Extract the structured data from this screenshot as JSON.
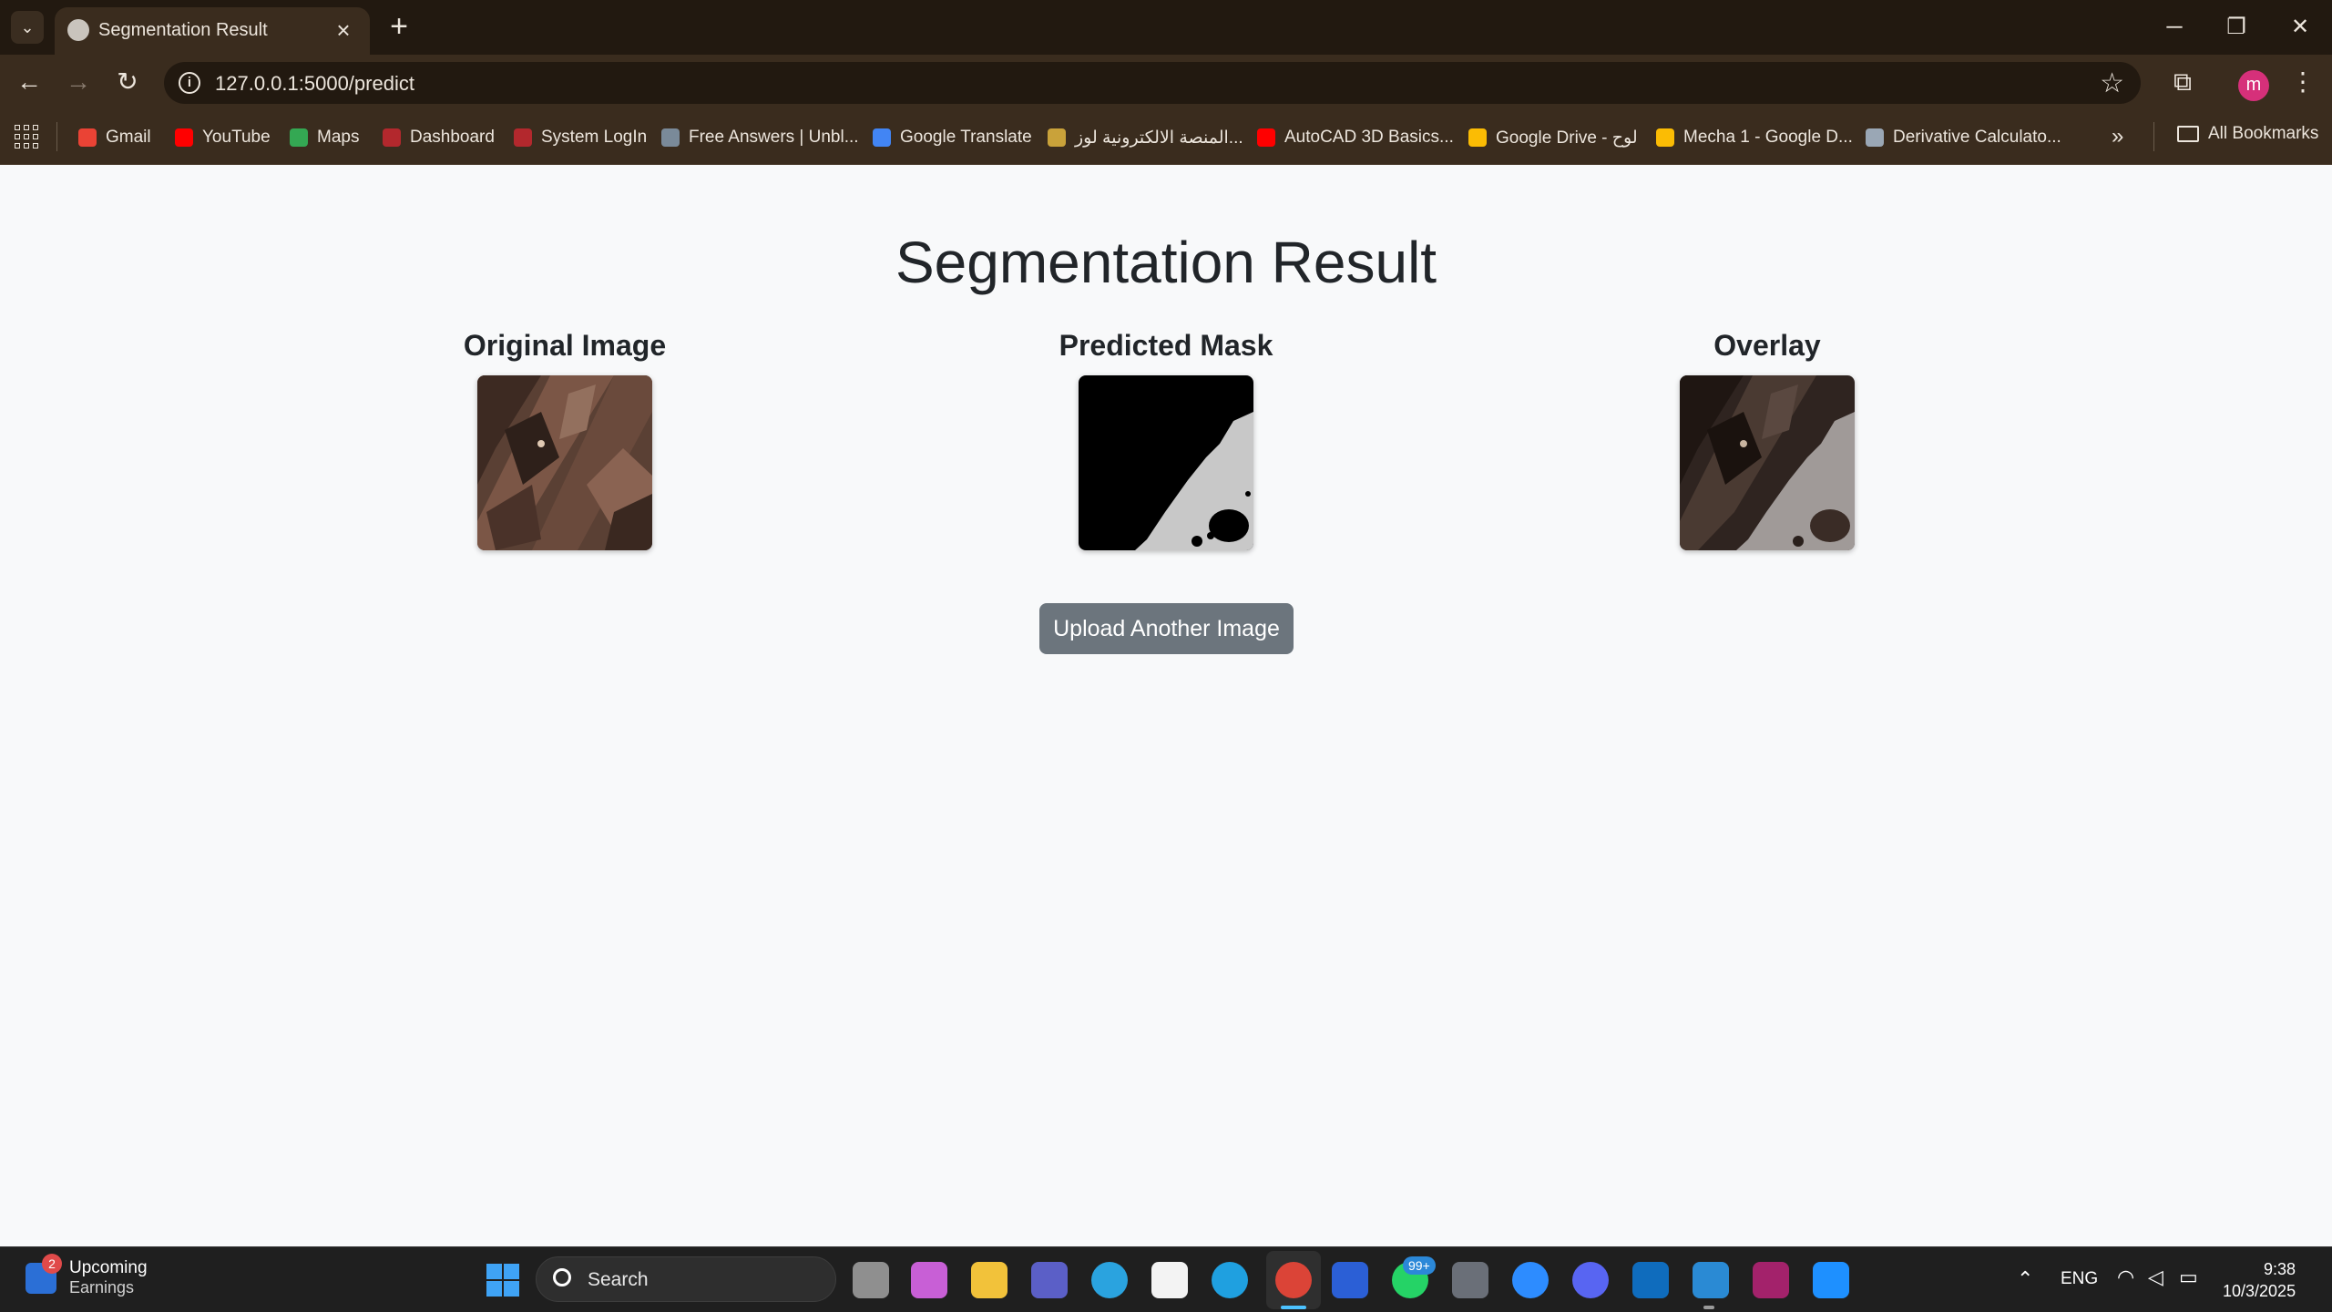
{
  "browser": {
    "tab_title": "Segmentation Result",
    "tab_close": "×",
    "new_tab": "+",
    "url": "127.0.0.1:5000/predict",
    "profile_initial": "m",
    "bookmarks": [
      {
        "label": "Gmail",
        "color": "#ea4335"
      },
      {
        "label": "YouTube",
        "color": "#ff0000"
      },
      {
        "label": "Maps",
        "color": "#34a853"
      },
      {
        "label": "Dashboard",
        "color": "#b3282d"
      },
      {
        "label": "System LogIn",
        "color": "#b3282d"
      },
      {
        "label": "Free Answers | Unbl...",
        "color": "#7a8a99"
      },
      {
        "label": "Google Translate",
        "color": "#4285f4"
      },
      {
        "label": "المنصة الالكترونية لوز...",
        "color": "#c9a23a"
      },
      {
        "label": "AutoCAD 3D Basics...",
        "color": "#ff0000"
      },
      {
        "label": "Google Drive - لوح",
        "color": "#fbbc04"
      },
      {
        "label": "Mecha 1 - Google D...",
        "color": "#fbbc04"
      },
      {
        "label": "Derivative Calculato...",
        "color": "#9aa7b5"
      }
    ],
    "more_bookmarks": "»",
    "all_bookmarks": "All Bookmarks"
  },
  "page": {
    "title": "Segmentation Result",
    "panels": [
      {
        "heading": "Original Image"
      },
      {
        "heading": "Predicted Mask"
      },
      {
        "heading": "Overlay"
      }
    ],
    "upload_button": "Upload Another Image"
  },
  "taskbar": {
    "widget_badge": "2",
    "widget_line1": "Upcoming",
    "widget_line2": "Earnings",
    "search_placeholder": "Search",
    "whatsapp_badge": "99+",
    "language": "ENG",
    "time": "9:38",
    "date": "10/3/2025"
  },
  "colors": {
    "page_background": "#f8f9fa",
    "button_secondary": "#6c757d",
    "browser_frame": "#3a2c1e"
  }
}
